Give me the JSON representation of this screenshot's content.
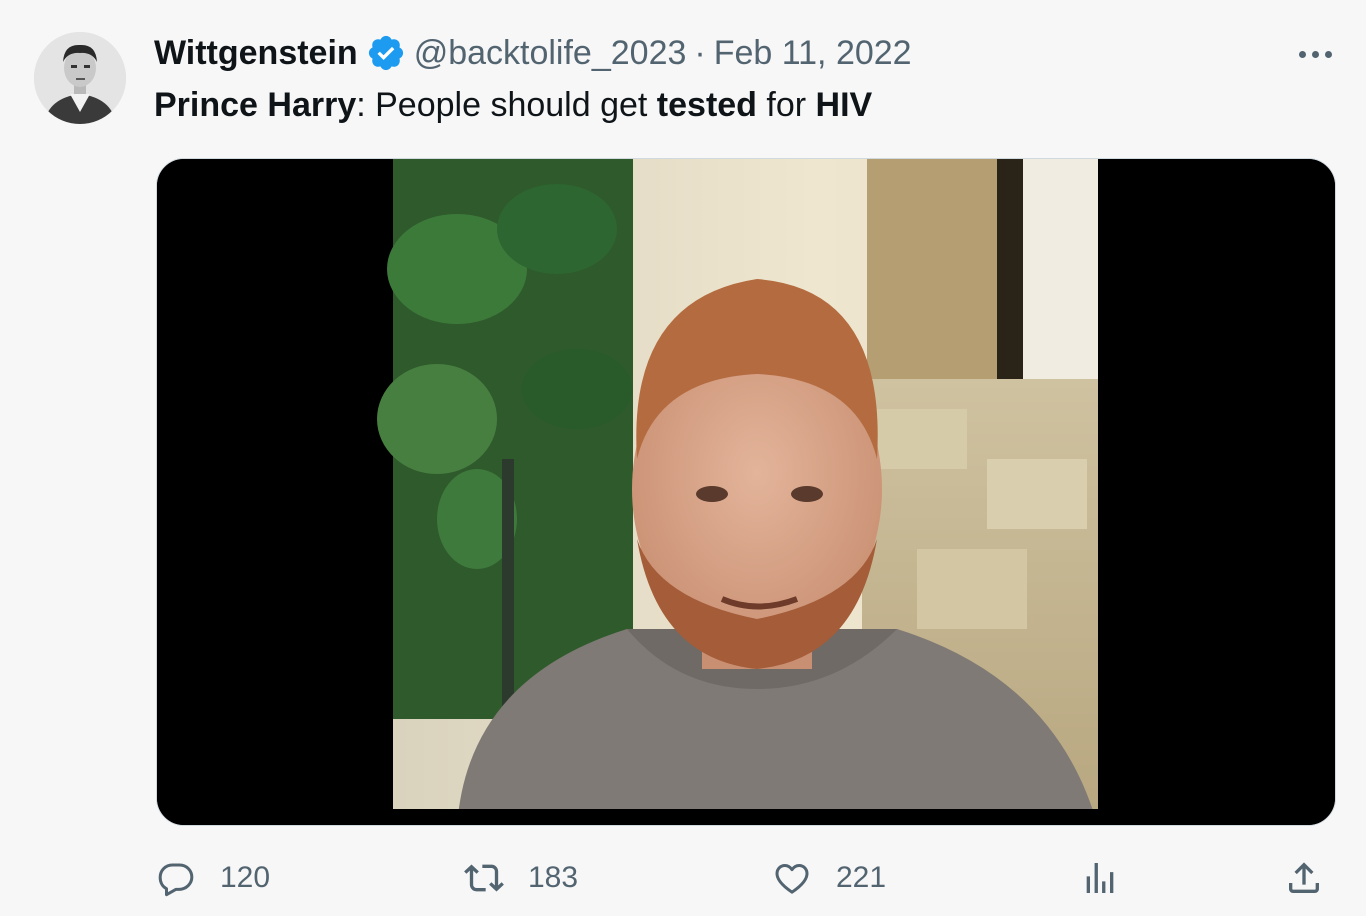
{
  "author": {
    "name": "Wittgenstein",
    "handle": "@backtolife_2023",
    "separator": "·",
    "date": "Feb 11, 2022",
    "verified": true
  },
  "tweet": {
    "text_part1": "Prince Harry",
    "text_part2": ": People should get ",
    "text_part3": "tested",
    "text_part4": " for ",
    "text_part5": "HIV"
  },
  "actions": {
    "replies": "120",
    "retweets": "183",
    "likes": "221"
  },
  "icons": {
    "more": "more-horizontal-icon",
    "reply": "reply-icon",
    "retweet": "retweet-icon",
    "like": "heart-icon",
    "views": "analytics-icon",
    "share": "share-icon",
    "verified": "verified-badge-icon"
  },
  "colors": {
    "background": "#f7f7f7",
    "text": "#0f1419",
    "secondary": "#536471",
    "verified": "#1d9bf0"
  }
}
